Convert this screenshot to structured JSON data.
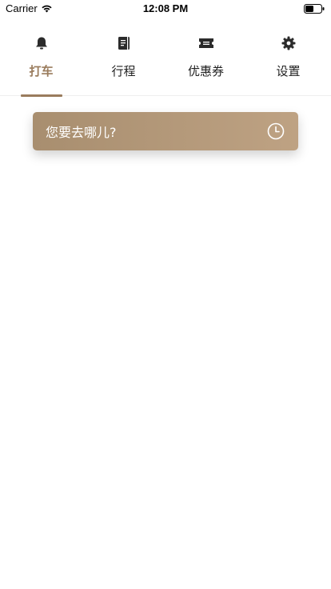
{
  "status_bar": {
    "carrier": "Carrier",
    "time": "12:08 PM"
  },
  "tabs": [
    {
      "label": "打车",
      "icon": "bell-icon",
      "active": true
    },
    {
      "label": "行程",
      "icon": "notebook-icon",
      "active": false
    },
    {
      "label": "优惠券",
      "icon": "ticket-icon",
      "active": false
    },
    {
      "label": "设置",
      "icon": "gear-icon",
      "active": false
    }
  ],
  "search": {
    "placeholder": "您要去哪儿?",
    "icon": "clock-icon"
  },
  "colors": {
    "accent": "#9a7c5d",
    "search_gradient_start": "#a88e6f",
    "search_gradient_end": "#bea283"
  }
}
